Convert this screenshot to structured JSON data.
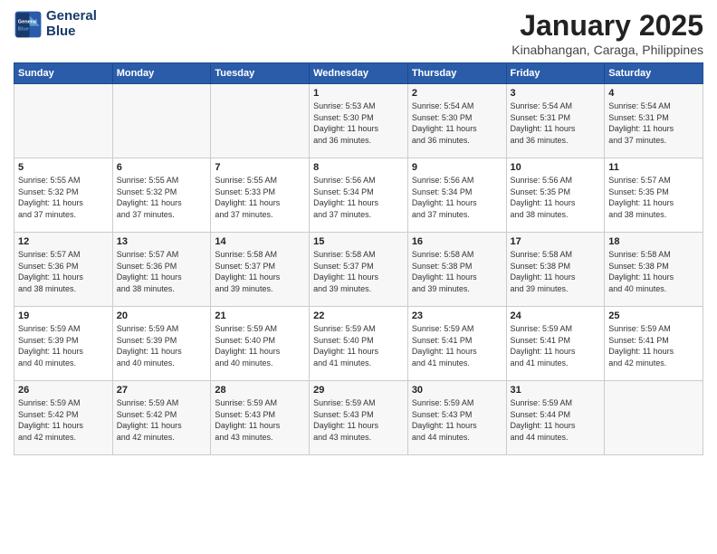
{
  "logo": {
    "line1": "General",
    "line2": "Blue"
  },
  "title": "January 2025",
  "subtitle": "Kinabhangan, Caraga, Philippines",
  "weekdays": [
    "Sunday",
    "Monday",
    "Tuesday",
    "Wednesday",
    "Thursday",
    "Friday",
    "Saturday"
  ],
  "weeks": [
    [
      {
        "day": "",
        "info": ""
      },
      {
        "day": "",
        "info": ""
      },
      {
        "day": "",
        "info": ""
      },
      {
        "day": "1",
        "info": "Sunrise: 5:53 AM\nSunset: 5:30 PM\nDaylight: 11 hours\nand 36 minutes."
      },
      {
        "day": "2",
        "info": "Sunrise: 5:54 AM\nSunset: 5:30 PM\nDaylight: 11 hours\nand 36 minutes."
      },
      {
        "day": "3",
        "info": "Sunrise: 5:54 AM\nSunset: 5:31 PM\nDaylight: 11 hours\nand 36 minutes."
      },
      {
        "day": "4",
        "info": "Sunrise: 5:54 AM\nSunset: 5:31 PM\nDaylight: 11 hours\nand 37 minutes."
      }
    ],
    [
      {
        "day": "5",
        "info": "Sunrise: 5:55 AM\nSunset: 5:32 PM\nDaylight: 11 hours\nand 37 minutes."
      },
      {
        "day": "6",
        "info": "Sunrise: 5:55 AM\nSunset: 5:32 PM\nDaylight: 11 hours\nand 37 minutes."
      },
      {
        "day": "7",
        "info": "Sunrise: 5:55 AM\nSunset: 5:33 PM\nDaylight: 11 hours\nand 37 minutes."
      },
      {
        "day": "8",
        "info": "Sunrise: 5:56 AM\nSunset: 5:34 PM\nDaylight: 11 hours\nand 37 minutes."
      },
      {
        "day": "9",
        "info": "Sunrise: 5:56 AM\nSunset: 5:34 PM\nDaylight: 11 hours\nand 37 minutes."
      },
      {
        "day": "10",
        "info": "Sunrise: 5:56 AM\nSunset: 5:35 PM\nDaylight: 11 hours\nand 38 minutes."
      },
      {
        "day": "11",
        "info": "Sunrise: 5:57 AM\nSunset: 5:35 PM\nDaylight: 11 hours\nand 38 minutes."
      }
    ],
    [
      {
        "day": "12",
        "info": "Sunrise: 5:57 AM\nSunset: 5:36 PM\nDaylight: 11 hours\nand 38 minutes."
      },
      {
        "day": "13",
        "info": "Sunrise: 5:57 AM\nSunset: 5:36 PM\nDaylight: 11 hours\nand 38 minutes."
      },
      {
        "day": "14",
        "info": "Sunrise: 5:58 AM\nSunset: 5:37 PM\nDaylight: 11 hours\nand 39 minutes."
      },
      {
        "day": "15",
        "info": "Sunrise: 5:58 AM\nSunset: 5:37 PM\nDaylight: 11 hours\nand 39 minutes."
      },
      {
        "day": "16",
        "info": "Sunrise: 5:58 AM\nSunset: 5:38 PM\nDaylight: 11 hours\nand 39 minutes."
      },
      {
        "day": "17",
        "info": "Sunrise: 5:58 AM\nSunset: 5:38 PM\nDaylight: 11 hours\nand 39 minutes."
      },
      {
        "day": "18",
        "info": "Sunrise: 5:58 AM\nSunset: 5:38 PM\nDaylight: 11 hours\nand 40 minutes."
      }
    ],
    [
      {
        "day": "19",
        "info": "Sunrise: 5:59 AM\nSunset: 5:39 PM\nDaylight: 11 hours\nand 40 minutes."
      },
      {
        "day": "20",
        "info": "Sunrise: 5:59 AM\nSunset: 5:39 PM\nDaylight: 11 hours\nand 40 minutes."
      },
      {
        "day": "21",
        "info": "Sunrise: 5:59 AM\nSunset: 5:40 PM\nDaylight: 11 hours\nand 40 minutes."
      },
      {
        "day": "22",
        "info": "Sunrise: 5:59 AM\nSunset: 5:40 PM\nDaylight: 11 hours\nand 41 minutes."
      },
      {
        "day": "23",
        "info": "Sunrise: 5:59 AM\nSunset: 5:41 PM\nDaylight: 11 hours\nand 41 minutes."
      },
      {
        "day": "24",
        "info": "Sunrise: 5:59 AM\nSunset: 5:41 PM\nDaylight: 11 hours\nand 41 minutes."
      },
      {
        "day": "25",
        "info": "Sunrise: 5:59 AM\nSunset: 5:41 PM\nDaylight: 11 hours\nand 42 minutes."
      }
    ],
    [
      {
        "day": "26",
        "info": "Sunrise: 5:59 AM\nSunset: 5:42 PM\nDaylight: 11 hours\nand 42 minutes."
      },
      {
        "day": "27",
        "info": "Sunrise: 5:59 AM\nSunset: 5:42 PM\nDaylight: 11 hours\nand 42 minutes."
      },
      {
        "day": "28",
        "info": "Sunrise: 5:59 AM\nSunset: 5:43 PM\nDaylight: 11 hours\nand 43 minutes."
      },
      {
        "day": "29",
        "info": "Sunrise: 5:59 AM\nSunset: 5:43 PM\nDaylight: 11 hours\nand 43 minutes."
      },
      {
        "day": "30",
        "info": "Sunrise: 5:59 AM\nSunset: 5:43 PM\nDaylight: 11 hours\nand 44 minutes."
      },
      {
        "day": "31",
        "info": "Sunrise: 5:59 AM\nSunset: 5:44 PM\nDaylight: 11 hours\nand 44 minutes."
      },
      {
        "day": "",
        "info": ""
      }
    ]
  ]
}
